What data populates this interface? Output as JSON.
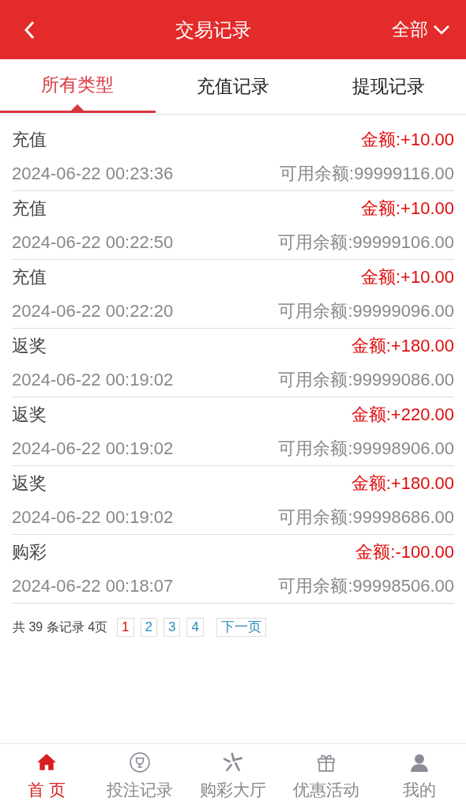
{
  "header": {
    "title": "交易记录",
    "filter": "全部"
  },
  "tabs": [
    {
      "label": "所有类型",
      "selected": true
    },
    {
      "label": "充值记录",
      "selected": false
    },
    {
      "label": "提现记录",
      "selected": false
    }
  ],
  "records": [
    {
      "type": "充值",
      "amount": "金额:+10.00",
      "time": "2024-06-22 00:23:36",
      "balance": "可用余额:99999116.00"
    },
    {
      "type": "充值",
      "amount": "金额:+10.00",
      "time": "2024-06-22 00:22:50",
      "balance": "可用余额:99999106.00"
    },
    {
      "type": "充值",
      "amount": "金额:+10.00",
      "time": "2024-06-22 00:22:20",
      "balance": "可用余额:99999096.00"
    },
    {
      "type": "返奖",
      "amount": "金额:+180.00",
      "time": "2024-06-22 00:19:02",
      "balance": "可用余额:99999086.00"
    },
    {
      "type": "返奖",
      "amount": "金额:+220.00",
      "time": "2024-06-22 00:19:02",
      "balance": "可用余额:99998906.00"
    },
    {
      "type": "返奖",
      "amount": "金额:+180.00",
      "time": "2024-06-22 00:19:02",
      "balance": "可用余额:99998686.00"
    },
    {
      "type": "购彩",
      "amount": "金额:-100.00",
      "time": "2024-06-22 00:18:07",
      "balance": "可用余额:99998506.00"
    }
  ],
  "pager": {
    "summary": "共 39 条记录 4页",
    "pages": [
      {
        "label": "1",
        "selected": true
      },
      {
        "label": "2",
        "selected": false
      },
      {
        "label": "3",
        "selected": false
      },
      {
        "label": "4",
        "selected": false
      }
    ],
    "next": "下一页"
  },
  "bottom_nav": [
    {
      "kind": "home",
      "label": "首 页",
      "selected": true
    },
    {
      "kind": "trophy",
      "label": "投注记录",
      "selected": false
    },
    {
      "kind": "star",
      "label": "购彩大厅",
      "selected": false
    },
    {
      "kind": "gift",
      "label": "优惠活动",
      "selected": false
    },
    {
      "kind": "user",
      "label": "我的",
      "selected": false
    }
  ]
}
